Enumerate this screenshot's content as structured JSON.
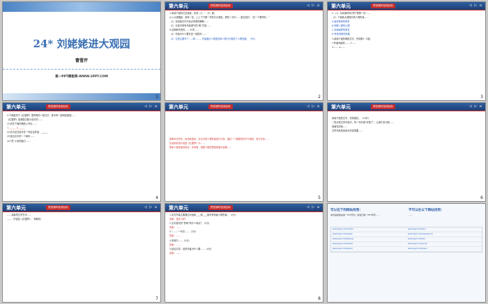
{
  "slides": [
    {
      "number": "1",
      "title": "24* 刘姥姥进大观园",
      "author": "曹雪芹",
      "footer": "第一PPT模板网-WWW.1PPT.COM"
    },
    {
      "number": "2",
      "unit": "第六单元",
      "tag": "预览课时检测目标",
      "controls": "◁ ▷ ⌂",
      "text": [
        "1.阅读下面的文言选段，完成（1）~（4）题。",
        "从入大观园起，各有一定，上上下下都一齐给与大观赏。那些丫头们……宝玉因问：“这一个果然好。”",
        "（1）对阅读文字中加点词语的解释……",
        "（2）文段中带有书面语气的“明”字是……",
        "A.这两种东西的……  B.有……",
        "（3）作者为什么要写这一段描写……",
        "（4）文段主要写了……和……，作者通过人物语言和人物行为表现了人物性格。（3分）"
      ]
    },
    {
      "number": "3",
      "unit": "第六单元",
      "tag": "预览课时检测目标",
      "controls": "◁ ▷ ⌂",
      "text": [
        "2.（1）对阅读材料中的“梧桐一页”……",
        "（2）下面各大观园中的人物形象……",
        "A.曲折离奇的故事",
        "B.体察入微的心理",
        "C.诙谐幽默的语言",
        "D.夸张滑稽的风格",
        "3.阅读下面的两段文字，完成第1~2题。",
        "①作者刻画的……   ②……",
        "③……   ④……"
      ]
    },
    {
      "number": "4",
      "unit": "第六单元",
      "tag": "预览课时检测目标",
      "controls": "◁ ▷ ⌂",
      "text": [
        "4.下面是关于《红楼梦》里贾母的一段文字，其中有一处明显错误……",
        "《红楼梦》是我国古典小说中的……",
        "(1)请在下面的横线上写出……",
        "①______  ②______",
        "(2)请为空白处补充一句恰当的话：______",
        "(3)找出文中的一个病句……",
        "(4)“把”小说的魅力……"
      ]
    },
    {
      "number": "5",
      "unit": "第六单元",
      "tag": "预览课时检测目标",
      "controls": "◁ ▷ ⌂",
      "text": [
        "参照本文所写，用全新语言，对文中的人物形象进行分析，通过一个典型的情节与场景，进行分析……",
        "比较精彩的片段是《红楼梦》中……",
        "思考人物形象的特点、作用等，把握人物的思想性格与精神……"
      ]
    },
    {
      "number": "6",
      "unit": "第六单元",
      "tag": "预览课时检测目标",
      "controls": "◁ ▷ ⌂",
      "text": [
        "阅读下面的文字，完成题目。（19分）",
        "一些大型文学作品中，有一句评语“好极了”，让我们意识到……",
        "读者在阅读……",
        "文学作品的阅读与欣赏需要……"
      ]
    },
    {
      "number": "7",
      "unit": "第六单元",
      "tag": "预览课时检测目标",
      "controls": "◁ ▷ ⌂",
      "text": [
        "……读者把文学艺术……",
        "……（节选自《红楼梦》，有删改）"
      ]
    },
    {
      "number": "8",
      "unit": "第六单元",
      "tag": "预览课时检测目标",
      "controls": "◁ ▷ ⌂",
      "text": [
        "1.本文作者主要通过对话和____和____描写来刻画人物形象。（2分）",
        "答案：语言 动作",
        "2.文中描写的“贾母”有什么特点？（2分）",
        "答案：……",
        "3.“……”一句中……（2分）",
        "答案：……",
        "4.本段中……（2分）",
        "答案：……",
        "5.结合文章，说说作者为什么要……（4分）",
        "答案：……"
      ]
    },
    {
      "number": "9",
      "logo_main": "第",
      "logo_one": "一",
      "logo_rest": "PPT",
      "left_title": "可以在下列网站找到：",
      "right_title": "不可以在以下网站找到：",
      "left_text": "本作品模板由第一PPT原创，版权归第一PPT所有……",
      "right_text": "……",
      "links": [
        [
          "www.1ppt.com/moban/",
          "www.1ppt.com/jieri/"
        ],
        [
          "www.1ppt.com/xiazai/",
          "www.1ppt.com/powerpoint/"
        ],
        [
          "www.1ppt.com/beijing/",
          "www.1ppt.com/ziti/"
        ],
        [
          "www.1ppt.com/tubiao/",
          "www.1ppt.com/sucai/"
        ],
        [
          "www.1ppt.com/jiaoan/",
          "www.1ppt.com/ziliao/"
        ]
      ]
    }
  ],
  "colors": {
    "bar": "#1f3f75",
    "tag": "#c62b2b",
    "title": "#3a6fb3"
  }
}
